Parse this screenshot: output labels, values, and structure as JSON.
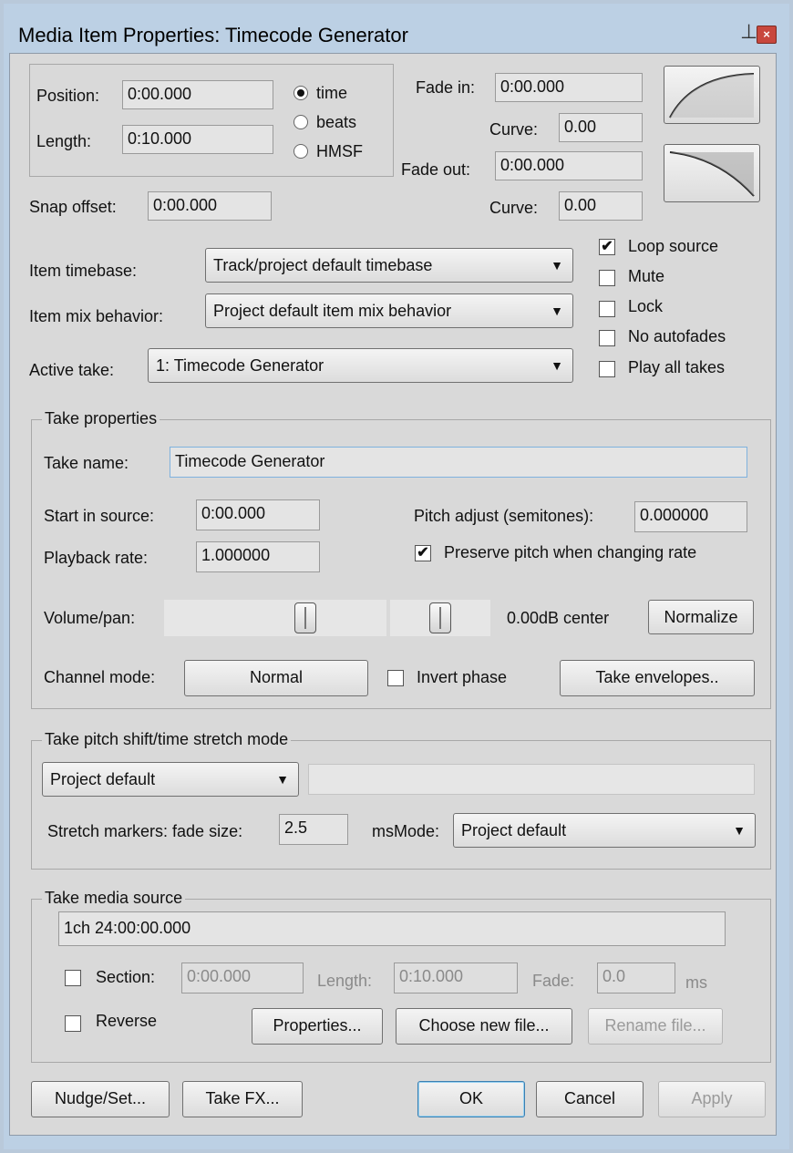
{
  "window": {
    "title": "Media Item Properties:  Timecode Generator",
    "pin_icon": "pin-icon",
    "close_icon": "close-icon"
  },
  "position": {
    "label": "Position:",
    "value": "0:00.000"
  },
  "length": {
    "label": "Length:",
    "value": "0:10.000"
  },
  "time_format": {
    "options": [
      "time",
      "beats",
      "HMSF"
    ],
    "selected": "time"
  },
  "fade_in": {
    "label": "Fade in:",
    "value": "0:00.000",
    "curve_label": "Curve:",
    "curve_value": "0.00"
  },
  "fade_out": {
    "label": "Fade out:",
    "value": "0:00.000",
    "curve_label": "Curve:",
    "curve_value": "0.00"
  },
  "snap_offset": {
    "label": "Snap offset:",
    "value": "0:00.000"
  },
  "item_timebase": {
    "label": "Item timebase:",
    "value": "Track/project default timebase"
  },
  "item_mix": {
    "label": "Item mix behavior:",
    "value": "Project default item mix behavior"
  },
  "active_take": {
    "label": "Active take:",
    "value": "1: Timecode Generator"
  },
  "checks": {
    "loop_source": {
      "label": "Loop source",
      "checked": true
    },
    "mute": {
      "label": "Mute",
      "checked": false
    },
    "lock": {
      "label": "Lock",
      "checked": false
    },
    "no_autofades": {
      "label": "No autofades",
      "checked": false
    },
    "play_all_takes": {
      "label": "Play all takes",
      "checked": false
    }
  },
  "take_properties": {
    "group_label": "Take properties",
    "take_name_label": "Take name:",
    "take_name": "Timecode Generator",
    "start_in_source_label": "Start in source:",
    "start_in_source": "0:00.000",
    "pitch_label": "Pitch adjust (semitones):",
    "pitch": "0.000000",
    "playback_rate_label": "Playback rate:",
    "playback_rate": "1.000000",
    "preserve_pitch_label": "Preserve pitch when changing rate",
    "preserve_pitch": true,
    "volpan_label": "Volume/pan:",
    "volpan_readout": "0.00dB  center",
    "volume_level": 0.65,
    "pan_level": 0.5,
    "normalize_label": "Normalize",
    "channel_mode_label": "Channel mode:",
    "channel_mode": "Normal",
    "invert_phase_label": "Invert phase",
    "invert_phase": false,
    "take_envelopes_label": "Take envelopes.."
  },
  "pitch_shift": {
    "group_label": "Take pitch shift/time stretch mode",
    "mode": "Project default",
    "submode": "",
    "stretch_label": "Stretch markers: fade size:",
    "fade_size": "2.5",
    "ms_label": "ms",
    "mode_label": "Mode:",
    "mode_value": "Project default"
  },
  "media_source": {
    "group_label": "Take media source",
    "source": "1ch 24:00:00.000",
    "section_label": "Section:",
    "section_value": "0:00.000",
    "length_label": "Length:",
    "length_value": "0:10.000",
    "fade_label": "Fade:",
    "fade_value": "0.0",
    "ms_label": "ms",
    "reverse_label": "Reverse",
    "properties_label": "Properties...",
    "choose_label": "Choose new file...",
    "rename_label": "Rename file..."
  },
  "bottom": {
    "nudge": "Nudge/Set...",
    "take_fx": "Take FX...",
    "ok": "OK",
    "cancel": "Cancel",
    "apply": "Apply"
  }
}
